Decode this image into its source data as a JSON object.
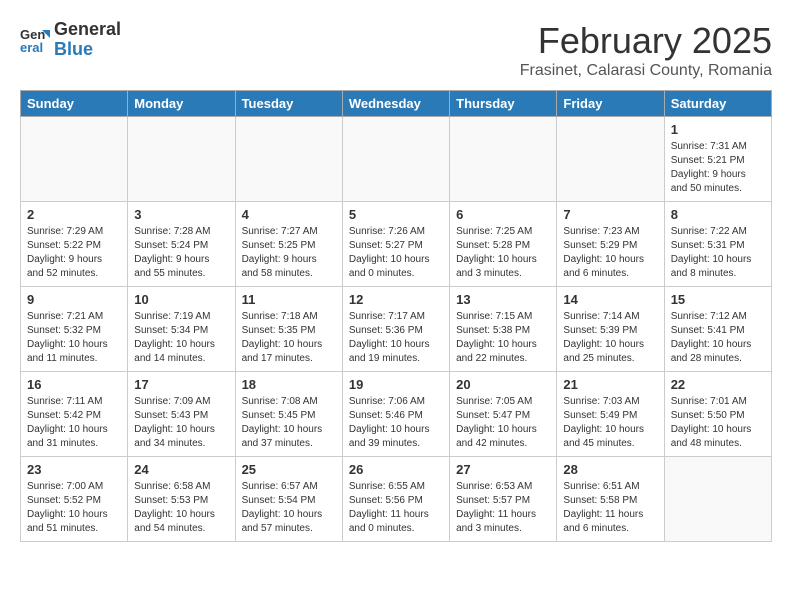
{
  "header": {
    "logo_general": "General",
    "logo_blue": "Blue",
    "title": "February 2025",
    "location": "Frasinet, Calarasi County, Romania"
  },
  "weekdays": [
    "Sunday",
    "Monday",
    "Tuesday",
    "Wednesday",
    "Thursday",
    "Friday",
    "Saturday"
  ],
  "weeks": [
    [
      {
        "day": "",
        "info": ""
      },
      {
        "day": "",
        "info": ""
      },
      {
        "day": "",
        "info": ""
      },
      {
        "day": "",
        "info": ""
      },
      {
        "day": "",
        "info": ""
      },
      {
        "day": "",
        "info": ""
      },
      {
        "day": "1",
        "info": "Sunrise: 7:31 AM\nSunset: 5:21 PM\nDaylight: 9 hours\nand 50 minutes."
      }
    ],
    [
      {
        "day": "2",
        "info": "Sunrise: 7:29 AM\nSunset: 5:22 PM\nDaylight: 9 hours\nand 52 minutes."
      },
      {
        "day": "3",
        "info": "Sunrise: 7:28 AM\nSunset: 5:24 PM\nDaylight: 9 hours\nand 55 minutes."
      },
      {
        "day": "4",
        "info": "Sunrise: 7:27 AM\nSunset: 5:25 PM\nDaylight: 9 hours\nand 58 minutes."
      },
      {
        "day": "5",
        "info": "Sunrise: 7:26 AM\nSunset: 5:27 PM\nDaylight: 10 hours\nand 0 minutes."
      },
      {
        "day": "6",
        "info": "Sunrise: 7:25 AM\nSunset: 5:28 PM\nDaylight: 10 hours\nand 3 minutes."
      },
      {
        "day": "7",
        "info": "Sunrise: 7:23 AM\nSunset: 5:29 PM\nDaylight: 10 hours\nand 6 minutes."
      },
      {
        "day": "8",
        "info": "Sunrise: 7:22 AM\nSunset: 5:31 PM\nDaylight: 10 hours\nand 8 minutes."
      }
    ],
    [
      {
        "day": "9",
        "info": "Sunrise: 7:21 AM\nSunset: 5:32 PM\nDaylight: 10 hours\nand 11 minutes."
      },
      {
        "day": "10",
        "info": "Sunrise: 7:19 AM\nSunset: 5:34 PM\nDaylight: 10 hours\nand 14 minutes."
      },
      {
        "day": "11",
        "info": "Sunrise: 7:18 AM\nSunset: 5:35 PM\nDaylight: 10 hours\nand 17 minutes."
      },
      {
        "day": "12",
        "info": "Sunrise: 7:17 AM\nSunset: 5:36 PM\nDaylight: 10 hours\nand 19 minutes."
      },
      {
        "day": "13",
        "info": "Sunrise: 7:15 AM\nSunset: 5:38 PM\nDaylight: 10 hours\nand 22 minutes."
      },
      {
        "day": "14",
        "info": "Sunrise: 7:14 AM\nSunset: 5:39 PM\nDaylight: 10 hours\nand 25 minutes."
      },
      {
        "day": "15",
        "info": "Sunrise: 7:12 AM\nSunset: 5:41 PM\nDaylight: 10 hours\nand 28 minutes."
      }
    ],
    [
      {
        "day": "16",
        "info": "Sunrise: 7:11 AM\nSunset: 5:42 PM\nDaylight: 10 hours\nand 31 minutes."
      },
      {
        "day": "17",
        "info": "Sunrise: 7:09 AM\nSunset: 5:43 PM\nDaylight: 10 hours\nand 34 minutes."
      },
      {
        "day": "18",
        "info": "Sunrise: 7:08 AM\nSunset: 5:45 PM\nDaylight: 10 hours\nand 37 minutes."
      },
      {
        "day": "19",
        "info": "Sunrise: 7:06 AM\nSunset: 5:46 PM\nDaylight: 10 hours\nand 39 minutes."
      },
      {
        "day": "20",
        "info": "Sunrise: 7:05 AM\nSunset: 5:47 PM\nDaylight: 10 hours\nand 42 minutes."
      },
      {
        "day": "21",
        "info": "Sunrise: 7:03 AM\nSunset: 5:49 PM\nDaylight: 10 hours\nand 45 minutes."
      },
      {
        "day": "22",
        "info": "Sunrise: 7:01 AM\nSunset: 5:50 PM\nDaylight: 10 hours\nand 48 minutes."
      }
    ],
    [
      {
        "day": "23",
        "info": "Sunrise: 7:00 AM\nSunset: 5:52 PM\nDaylight: 10 hours\nand 51 minutes."
      },
      {
        "day": "24",
        "info": "Sunrise: 6:58 AM\nSunset: 5:53 PM\nDaylight: 10 hours\nand 54 minutes."
      },
      {
        "day": "25",
        "info": "Sunrise: 6:57 AM\nSunset: 5:54 PM\nDaylight: 10 hours\nand 57 minutes."
      },
      {
        "day": "26",
        "info": "Sunrise: 6:55 AM\nSunset: 5:56 PM\nDaylight: 11 hours\nand 0 minutes."
      },
      {
        "day": "27",
        "info": "Sunrise: 6:53 AM\nSunset: 5:57 PM\nDaylight: 11 hours\nand 3 minutes."
      },
      {
        "day": "28",
        "info": "Sunrise: 6:51 AM\nSunset: 5:58 PM\nDaylight: 11 hours\nand 6 minutes."
      },
      {
        "day": "",
        "info": ""
      }
    ]
  ]
}
